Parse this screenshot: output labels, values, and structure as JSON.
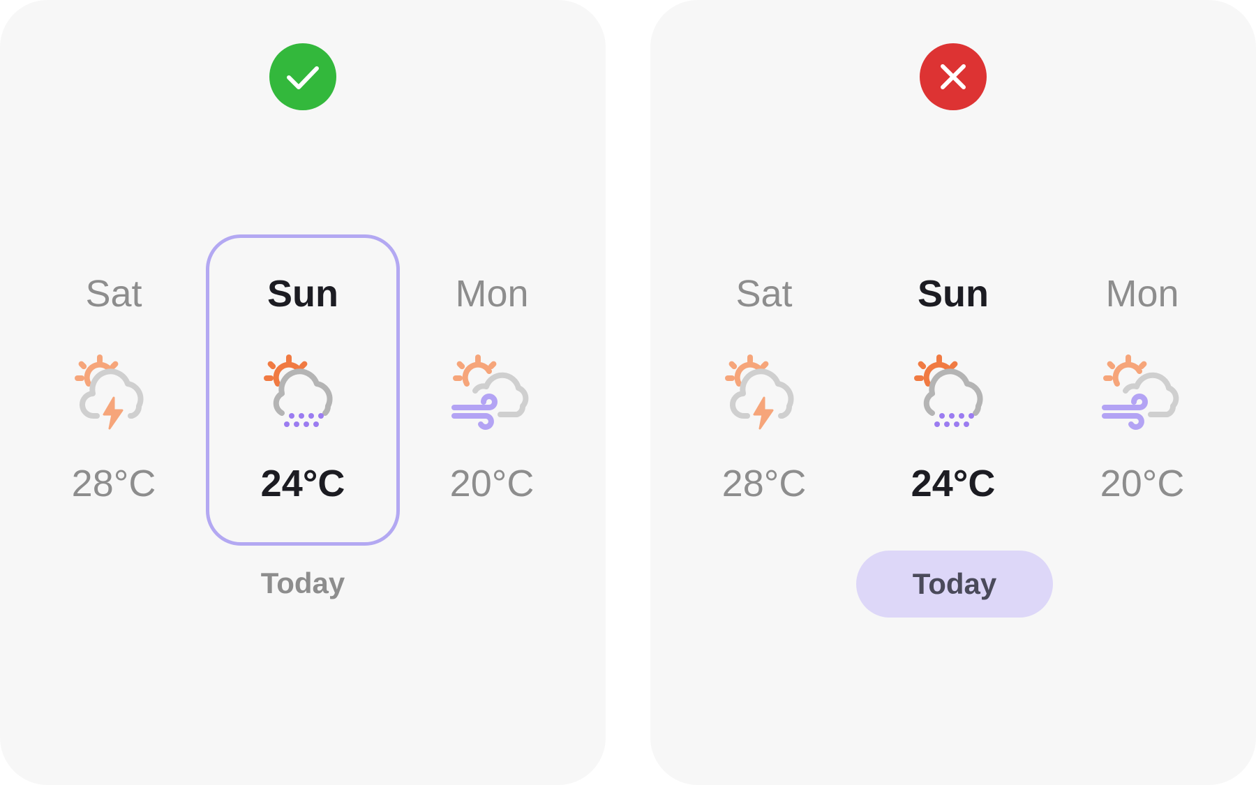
{
  "colors": {
    "panel_background": "#f7f7f7",
    "correct_badge": "#33b83c",
    "incorrect_badge": "#dd3333",
    "highlight_border": "#b3a8f2",
    "today_pill": "#ddd7f8",
    "text_active": "#1c1c22",
    "text_muted": "#8d8d8d"
  },
  "left_panel": {
    "badge_icon": "check-icon",
    "days": [
      {
        "name": "Sat",
        "temp": "28°C",
        "icon": "sun-cloud-thunder-icon"
      },
      {
        "name": "Sun",
        "temp": "24°C",
        "icon": "sun-cloud-snow-icon"
      },
      {
        "name": "Mon",
        "temp": "20°C",
        "icon": "sun-cloud-wind-icon"
      }
    ],
    "today_label": "Today"
  },
  "right_panel": {
    "badge_icon": "close-icon",
    "days": [
      {
        "name": "Sat",
        "temp": "28°C",
        "icon": "sun-cloud-thunder-icon"
      },
      {
        "name": "Sun",
        "temp": "24°C",
        "icon": "sun-cloud-snow-icon"
      },
      {
        "name": "Mon",
        "temp": "20°C",
        "icon": "sun-cloud-wind-icon"
      }
    ],
    "today_label": "Today"
  }
}
